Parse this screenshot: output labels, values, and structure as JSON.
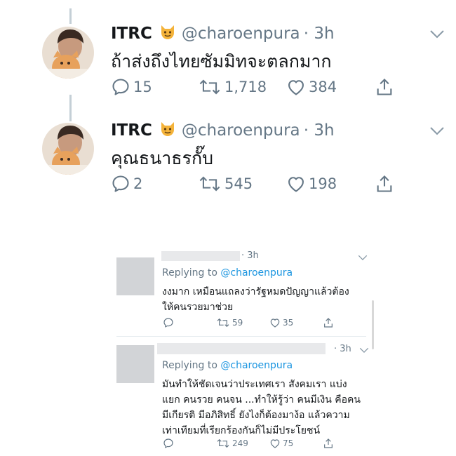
{
  "tweets": [
    {
      "name": "ITRC",
      "handle": "@charoenpura",
      "time": "· 3h",
      "text": "ถ้าส่งถึงไทยซัมมิทจะตลกมาก",
      "replies": "15",
      "retweets": "1,718",
      "likes": "384"
    },
    {
      "name": "ITRC",
      "handle": "@charoenpura",
      "time": "· 3h",
      "text": "คุณธนาธรกั๊บ",
      "replies": "2",
      "retweets": "545",
      "likes": "198"
    }
  ],
  "replies": [
    {
      "time": "· 3h",
      "replying_prefix": "Replying to ",
      "replying_to": "@charoenpura",
      "lines": [
        "งงมาก เหมือนแถลงว่ารัฐหมดปัญญาแล้วต้อง",
        "ให้คนรวยมาช่วย"
      ],
      "replies": "",
      "retweets": "59",
      "likes": "35"
    },
    {
      "time": "· 3h",
      "replying_prefix": "Replying to ",
      "replying_to": "@charoenpura",
      "lines": [
        "มันทำให้ชัดเจนว่าประเทศเรา สังคมเรา แบ่ง",
        "แยก คนรวย คนจน ...ทำให้รู้ว่า คนมีเงิน คือคน",
        "มีเกียรติ มีอภิสิทธิ์ ยังไงก็ต้องมาง้อ แล้วความ",
        "เท่าเทียมที่เรียกร้องกันก็ไม่มีประโยชน์"
      ],
      "replies": "",
      "retweets": "249",
      "likes": "75"
    }
  ],
  "icons": [
    "cat-emoji",
    "chevron-down-icon",
    "reply-icon",
    "retweet-icon",
    "like-icon",
    "share-icon"
  ],
  "colors": {
    "text": "#14171a",
    "secondary": "#657786",
    "mention": "#1b95e0"
  }
}
